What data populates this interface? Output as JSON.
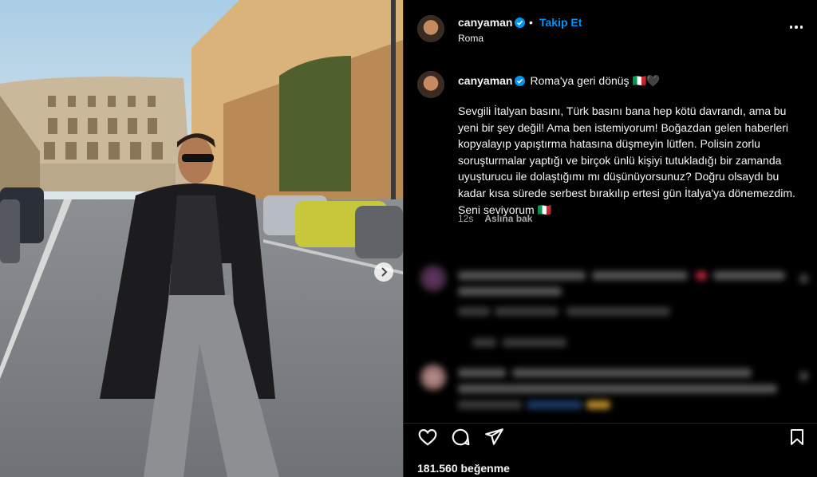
{
  "post": {
    "username": "canyaman",
    "follow_label": "Takip Et",
    "separator": "•",
    "location": "Roma",
    "caption_title": "Roma'ya geri dönüş 🇮🇹🖤",
    "caption_body": "Sevgili İtalyan basını, Türk basını bana hep kötü davrandı, ama bu yeni bir şey değil! Ama ben istemiyorum! Boğazdan gelen haberleri kopyalayıp yapıştırma hatasına düşmeyin lütfen. Polisin zorlu soruşturmalar yaptığı ve birçok ünlü kişiyi tutukladığı bir zamanda uyuşturucu ile dolaştığımı mı düşünüyorsunuz? Doğru olsaydı bu kadar kısa sürede serbest bırakılıp ertesi gün İtalya'ya dönemezdim. Seni seviyorum 🇮🇹",
    "time_ago": "12s",
    "see_translation": "Aslına bak",
    "likes": "181.560 beğenme"
  },
  "icons": {
    "verified": "verified-badge-icon",
    "more": "more-options-icon",
    "like": "heart-icon",
    "comment": "comment-icon",
    "share": "paper-plane-icon",
    "save": "bookmark-icon",
    "next": "chevron-right-icon"
  },
  "colors": {
    "background": "#000000",
    "text": "#f5f5f5",
    "secondary_text": "#a8a8a8",
    "accent": "#0095f6",
    "divider": "#262626"
  }
}
